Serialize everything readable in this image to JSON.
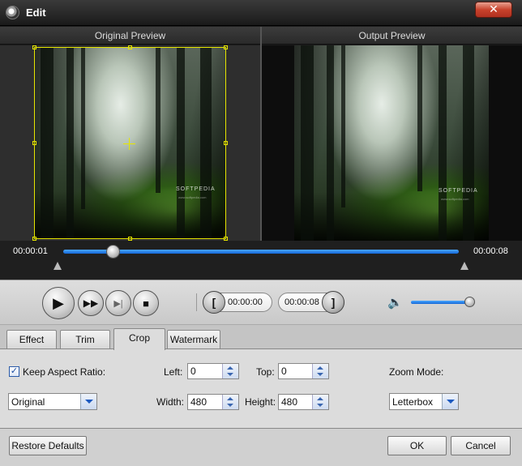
{
  "window": {
    "title": "Edit",
    "close_label": "✕"
  },
  "preview": {
    "original_label": "Original Preview",
    "output_label": "Output Preview",
    "watermark_text": "SOFTPEDIA",
    "watermark_url": "www.softpedia.com"
  },
  "timeline": {
    "current_time": "00:00:01",
    "end_time": "00:00:08",
    "progress": 0.125
  },
  "controls": {
    "play_icon": "▶",
    "ff_icon": "▶▶",
    "frame_icon": "▶|",
    "stop_icon": "■",
    "trim_start_bracket": "[",
    "trim_end_bracket": "]",
    "trim_start_time": "00:00:00",
    "trim_end_time": "00:00:08",
    "volume_icon": "🔈",
    "volume_level": 1.0
  },
  "tabs": [
    {
      "label": "Effect"
    },
    {
      "label": "Trim"
    },
    {
      "label": "Crop",
      "active": true
    },
    {
      "label": "Watermark"
    }
  ],
  "crop": {
    "keep_aspect_label": "Keep Aspect Ratio:",
    "keep_aspect_checked": "✓",
    "left_label": "Left:",
    "left_value": "0",
    "top_label": "Top:",
    "top_value": "0",
    "zoom_mode_label": "Zoom Mode:",
    "aspect_select_value": "Original",
    "width_label": "Width:",
    "width_value": "480",
    "height_label": "Height:",
    "height_value": "480",
    "zoom_mode_value": "Letterbox"
  },
  "footer": {
    "restore_label": "Restore Defaults",
    "ok_label": "OK",
    "cancel_label": "Cancel"
  },
  "colors": {
    "accent_blue": "#1366d6",
    "crop_frame": "#e6e600",
    "close_red": "#c8422c"
  }
}
